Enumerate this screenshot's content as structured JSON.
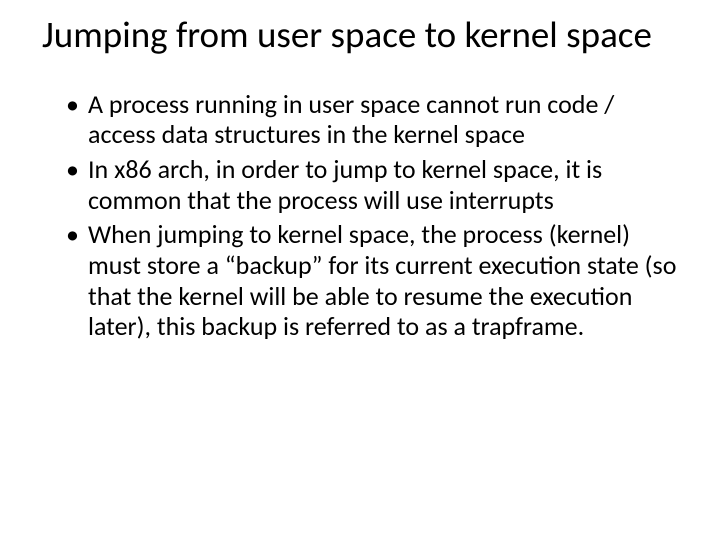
{
  "title": "Jumping from user space to kernel space",
  "bullets": [
    " A process running in user space cannot run code / access data structures in the kernel space",
    "In x86 arch, in order to jump to kernel space, it is common that the process will use interrupts",
    "When jumping to kernel space, the process (kernel) must store a “backup” for its current execution state (so that the kernel will be able to resume the execution later), this backup is referred to as a trapframe."
  ]
}
